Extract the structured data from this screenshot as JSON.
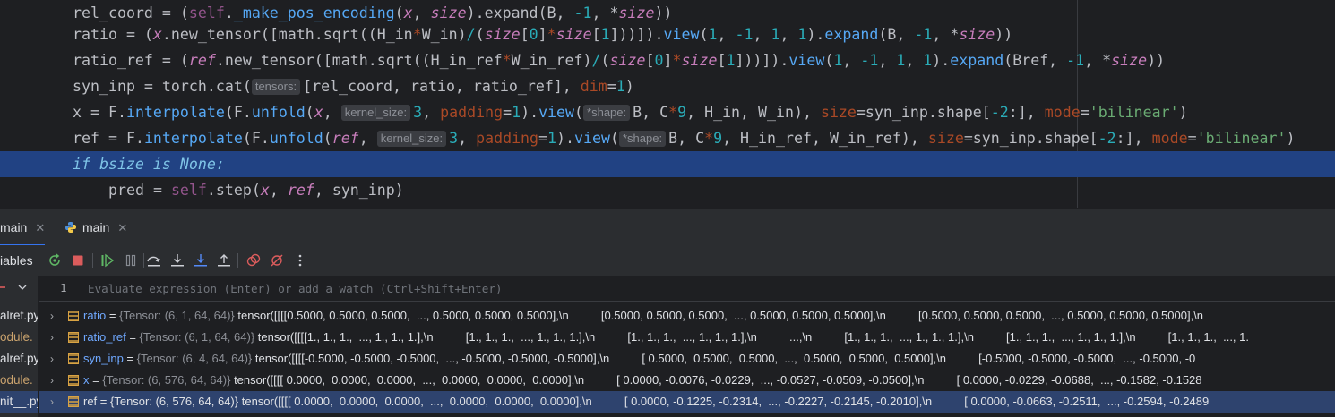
{
  "editor": {
    "lines": [
      {
        "id": "l1",
        "segments": [
          [
            "attr",
            "rel_coord = ("
          ],
          [
            "self",
            "self"
          ],
          [
            "attr",
            "."
          ],
          [
            "fn",
            "_make_pos_encoding"
          ],
          [
            "attr",
            "("
          ],
          [
            "var",
            "x"
          ],
          [
            "attr",
            ", "
          ],
          [
            "var",
            "size"
          ],
          [
            "attr",
            ")."
          ],
          [
            "attr",
            "expand"
          ],
          [
            "attr",
            "(B, "
          ],
          [
            "num",
            "-1"
          ],
          [
            "attr",
            ", "
          ],
          [
            "op",
            "*"
          ],
          [
            "var",
            "size"
          ],
          [
            "attr",
            "))"
          ]
        ]
      },
      {
        "id": "l2",
        "segments": [
          [
            "attr",
            "ratio = ("
          ],
          [
            "var",
            "x"
          ],
          [
            "attr",
            "."
          ],
          [
            "attr",
            "new_tensor"
          ],
          [
            "attr",
            "([math."
          ],
          [
            "attr",
            "sqrt"
          ],
          [
            "attr",
            "((H_in"
          ],
          [
            "named",
            "*"
          ],
          [
            "attr",
            "W_in)"
          ],
          [
            "num",
            "/"
          ],
          [
            "attr",
            "("
          ],
          [
            "var",
            "size"
          ],
          [
            "attr",
            "["
          ],
          [
            "num",
            "0"
          ],
          [
            "attr",
            "]"
          ],
          [
            "named",
            "*"
          ],
          [
            "var",
            "size"
          ],
          [
            "attr",
            "["
          ],
          [
            "num",
            "1"
          ],
          [
            "attr",
            "]))])."
          ],
          [
            "fn",
            "view"
          ],
          [
            "attr",
            "("
          ],
          [
            "num",
            "1"
          ],
          [
            "attr",
            ", "
          ],
          [
            "num",
            "-1"
          ],
          [
            "attr",
            ", "
          ],
          [
            "num",
            "1"
          ],
          [
            "attr",
            ", "
          ],
          [
            "num",
            "1"
          ],
          [
            "attr",
            ")."
          ],
          [
            "fn",
            "expand"
          ],
          [
            "attr",
            "(B, "
          ],
          [
            "num",
            "-1"
          ],
          [
            "attr",
            ", "
          ],
          [
            "op",
            "*"
          ],
          [
            "var",
            "size"
          ],
          [
            "attr",
            "))"
          ]
        ]
      },
      {
        "id": "l3",
        "segments": [
          [
            "attr",
            "ratio_ref = ("
          ],
          [
            "var",
            "ref"
          ],
          [
            "attr",
            "."
          ],
          [
            "attr",
            "new_tensor"
          ],
          [
            "attr",
            "([math."
          ],
          [
            "attr",
            "sqrt"
          ],
          [
            "attr",
            "((H_in_ref"
          ],
          [
            "named",
            "*"
          ],
          [
            "attr",
            "W_in_ref)"
          ],
          [
            "num",
            "/"
          ],
          [
            "attr",
            "("
          ],
          [
            "var",
            "size"
          ],
          [
            "attr",
            "["
          ],
          [
            "num",
            "0"
          ],
          [
            "attr",
            "]"
          ],
          [
            "named",
            "*"
          ],
          [
            "var",
            "size"
          ],
          [
            "attr",
            "["
          ],
          [
            "num",
            "1"
          ],
          [
            "attr",
            "]))])."
          ],
          [
            "fn",
            "view"
          ],
          [
            "attr",
            "("
          ],
          [
            "num",
            "1"
          ],
          [
            "attr",
            ", "
          ],
          [
            "num",
            "-1"
          ],
          [
            "attr",
            ", "
          ],
          [
            "num",
            "1"
          ],
          [
            "attr",
            ", "
          ],
          [
            "num",
            "1"
          ],
          [
            "attr",
            ")."
          ],
          [
            "fn",
            "expand"
          ],
          [
            "attr",
            "(Bref, "
          ],
          [
            "num",
            "-1"
          ],
          [
            "attr",
            ", "
          ],
          [
            "op",
            "*"
          ],
          [
            "var",
            "size"
          ],
          [
            "attr",
            "))"
          ]
        ]
      },
      {
        "id": "l4",
        "segments": [
          [
            "attr",
            "syn_inp = torch."
          ],
          [
            "attr",
            "cat"
          ],
          [
            "attr",
            "("
          ],
          [
            "hint",
            "tensors:"
          ],
          [
            "attr",
            "[rel_coord, ratio, ratio_ref], "
          ],
          [
            "named",
            "dim"
          ],
          [
            "attr",
            "="
          ],
          [
            "num",
            "1"
          ],
          [
            "attr",
            ")"
          ]
        ]
      },
      {
        "id": "l5",
        "segments": [
          [
            "attr",
            "x = F."
          ],
          [
            "fn",
            "interpolate"
          ],
          [
            "attr",
            "(F."
          ],
          [
            "fn",
            "unfold"
          ],
          [
            "attr",
            "("
          ],
          [
            "var",
            "x"
          ],
          [
            "attr",
            ", "
          ],
          [
            "hint",
            "kernel_size:"
          ],
          [
            "num",
            "3"
          ],
          [
            "attr",
            ", "
          ],
          [
            "named",
            "padding"
          ],
          [
            "attr",
            "="
          ],
          [
            "num",
            "1"
          ],
          [
            "attr",
            ")."
          ],
          [
            "fn",
            "view"
          ],
          [
            "attr",
            "("
          ],
          [
            "hint",
            "*shape:"
          ],
          [
            "attr",
            "B, C"
          ],
          [
            "named",
            "*"
          ],
          [
            "num",
            "9"
          ],
          [
            "attr",
            ", H_in, W_in), "
          ],
          [
            "named",
            "size"
          ],
          [
            "attr",
            "=syn_inp.shape["
          ],
          [
            "num",
            "-2"
          ],
          [
            "attr",
            ":], "
          ],
          [
            "named",
            "mode"
          ],
          [
            "attr",
            "="
          ],
          [
            "str",
            "'bilinear'"
          ],
          [
            "attr",
            ")"
          ]
        ]
      },
      {
        "id": "l6",
        "segments": [
          [
            "attr",
            "ref = F."
          ],
          [
            "fn",
            "interpolate"
          ],
          [
            "attr",
            "(F."
          ],
          [
            "fn",
            "unfold"
          ],
          [
            "attr",
            "("
          ],
          [
            "var",
            "ref"
          ],
          [
            "attr",
            ", "
          ],
          [
            "hint",
            "kernel_size:"
          ],
          [
            "num",
            "3"
          ],
          [
            "attr",
            ", "
          ],
          [
            "named",
            "padding"
          ],
          [
            "attr",
            "="
          ],
          [
            "num",
            "1"
          ],
          [
            "attr",
            ")."
          ],
          [
            "fn",
            "view"
          ],
          [
            "attr",
            "("
          ],
          [
            "hint",
            "*shape:"
          ],
          [
            "attr",
            "B, C"
          ],
          [
            "named",
            "*"
          ],
          [
            "num",
            "9"
          ],
          [
            "attr",
            ", H_in_ref, W_in_ref), "
          ],
          [
            "named",
            "size"
          ],
          [
            "attr",
            "=syn_inp.shape["
          ],
          [
            "num",
            "-2"
          ],
          [
            "attr",
            ":], "
          ],
          [
            "named",
            "mode"
          ],
          [
            "attr",
            "="
          ],
          [
            "str",
            "'bilinear'"
          ],
          [
            "attr",
            ")"
          ]
        ]
      },
      {
        "id": "l7",
        "highlight": true,
        "segments": [
          [
            "kwi",
            "if bsize is None:"
          ]
        ]
      },
      {
        "id": "l8",
        "indent": 2,
        "segments": [
          [
            "attr",
            "pred = "
          ],
          [
            "self",
            "self"
          ],
          [
            "attr",
            "."
          ],
          [
            "attr",
            "step"
          ],
          [
            "attr",
            "("
          ],
          [
            "var",
            "x"
          ],
          [
            "attr",
            ", "
          ],
          [
            "var",
            "ref"
          ],
          [
            "attr",
            ", syn_inp)"
          ]
        ]
      }
    ]
  },
  "tabs": [
    {
      "label": "main",
      "active": true
    },
    {
      "label": "main",
      "active": false,
      "icon": "python-icon"
    }
  ],
  "toolbar": {
    "label": "iables",
    "icons": [
      "rerun-icon",
      "stop-icon",
      "resume-icon",
      "pause-icon",
      "step-over-icon",
      "step-into-icon",
      "step-into-my-code-icon",
      "step-out-icon",
      "view-breakpoints-icon",
      "mute-breakpoints-icon",
      "more-icon"
    ]
  },
  "frames": [
    {
      "label": "alref.py",
      "kind": "file"
    },
    {
      "label": "odule.",
      "kind": "mod"
    },
    {
      "label": "alref.py",
      "kind": "file"
    },
    {
      "label": "odule.",
      "kind": "mod"
    },
    {
      "label": "nit__.py",
      "kind": "file",
      "selected": true
    }
  ],
  "watch": {
    "line_number": "1",
    "placeholder": "Evaluate expression (Enter) or add a watch (Ctrl+Shift+Enter)"
  },
  "variables": [
    {
      "name": "ratio",
      "type": "{Tensor: (6, 1, 64, 64)}",
      "value": "tensor([[[[0.5000, 0.5000, 0.5000,  ..., 0.5000, 0.5000, 0.5000],\\n          [0.5000, 0.5000, 0.5000,  ..., 0.5000, 0.5000, 0.5000],\\n          [0.5000, 0.5000, 0.5000,  ..., 0.5000, 0.5000, 0.5000],\\n"
    },
    {
      "name": "ratio_ref",
      "type": "{Tensor: (6, 1, 64, 64)}",
      "value": "tensor([[[[1., 1., 1.,  ..., 1., 1., 1.],\\n          [1., 1., 1.,  ..., 1., 1., 1.],\\n          [1., 1., 1.,  ..., 1., 1., 1.],\\n          ...,\\n          [1., 1., 1.,  ..., 1., 1., 1.],\\n          [1., 1., 1.,  ..., 1., 1., 1.],\\n          [1., 1., 1.,  ..., 1."
    },
    {
      "name": "syn_inp",
      "type": "{Tensor: (6, 4, 64, 64)}",
      "value": "tensor([[[[-0.5000, -0.5000, -0.5000,  ..., -0.5000, -0.5000, -0.5000],\\n          [ 0.5000,  0.5000,  0.5000,  ...,  0.5000,  0.5000,  0.5000],\\n          [-0.5000, -0.5000, -0.5000,  ..., -0.5000, -0"
    },
    {
      "name": "x",
      "type": "{Tensor: (6, 576, 64, 64)}",
      "value": "tensor([[[[ 0.0000,  0.0000,  0.0000,  ...,  0.0000,  0.0000,  0.0000],\\n          [ 0.0000, -0.0076, -0.0229,  ..., -0.0527, -0.0509, -0.0500],\\n          [ 0.0000, -0.0229, -0.0688,  ..., -0.1582, -0.1528"
    },
    {
      "name": "ref",
      "type": "{Tensor: (6, 576, 64, 64)}",
      "value": "tensor([[[[ 0.0000,  0.0000,  0.0000,  ...,  0.0000,  0.0000,  0.0000],\\n          [ 0.0000, -0.1225, -0.2314,  ..., -0.2227, -0.2145, -0.2010],\\n          [ 0.0000, -0.0663, -0.2511,  ..., -0.2594, -0.2489",
      "selected": true
    }
  ],
  "colors": {
    "editor_bg": "#1e1f22",
    "panel_bg": "#2b2d30",
    "selection": "#214283",
    "row_selection": "#2e436e",
    "accent": "#3574f0"
  }
}
